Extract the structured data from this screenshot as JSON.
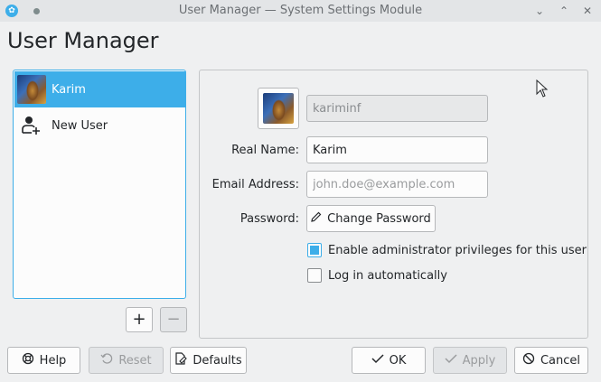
{
  "window": {
    "title": "User Manager — System Settings Module",
    "minimize_glyph": "⌄",
    "maximize_glyph": "⌃",
    "close_glyph": "✕"
  },
  "page_title": "User Manager",
  "user_list": {
    "items": [
      {
        "label": "Karim",
        "icon": "user-avatar",
        "selected": true
      },
      {
        "label": "New User",
        "icon": "add-user-icon",
        "selected": false
      }
    ],
    "add_glyph": "+",
    "remove_glyph": "−"
  },
  "details": {
    "username": "kariminf",
    "real_name_label": "Real Name:",
    "real_name_value": "Karim",
    "email_label": "Email Address:",
    "email_placeholder": "john.doe@example.com",
    "password_label": "Password:",
    "change_password_label": "Change Password",
    "admin_label": "Enable administrator privileges for this user",
    "admin_checked": true,
    "autologin_label": "Log in automatically",
    "autologin_checked": false
  },
  "footer": {
    "help_label": "Help",
    "reset_label": "Reset",
    "defaults_label": "Defaults",
    "ok_label": "OK",
    "apply_label": "Apply",
    "cancel_label": "Cancel"
  },
  "colors": {
    "accent": "#3daee9",
    "window_bg": "#eff0f1",
    "text": "#232629"
  }
}
